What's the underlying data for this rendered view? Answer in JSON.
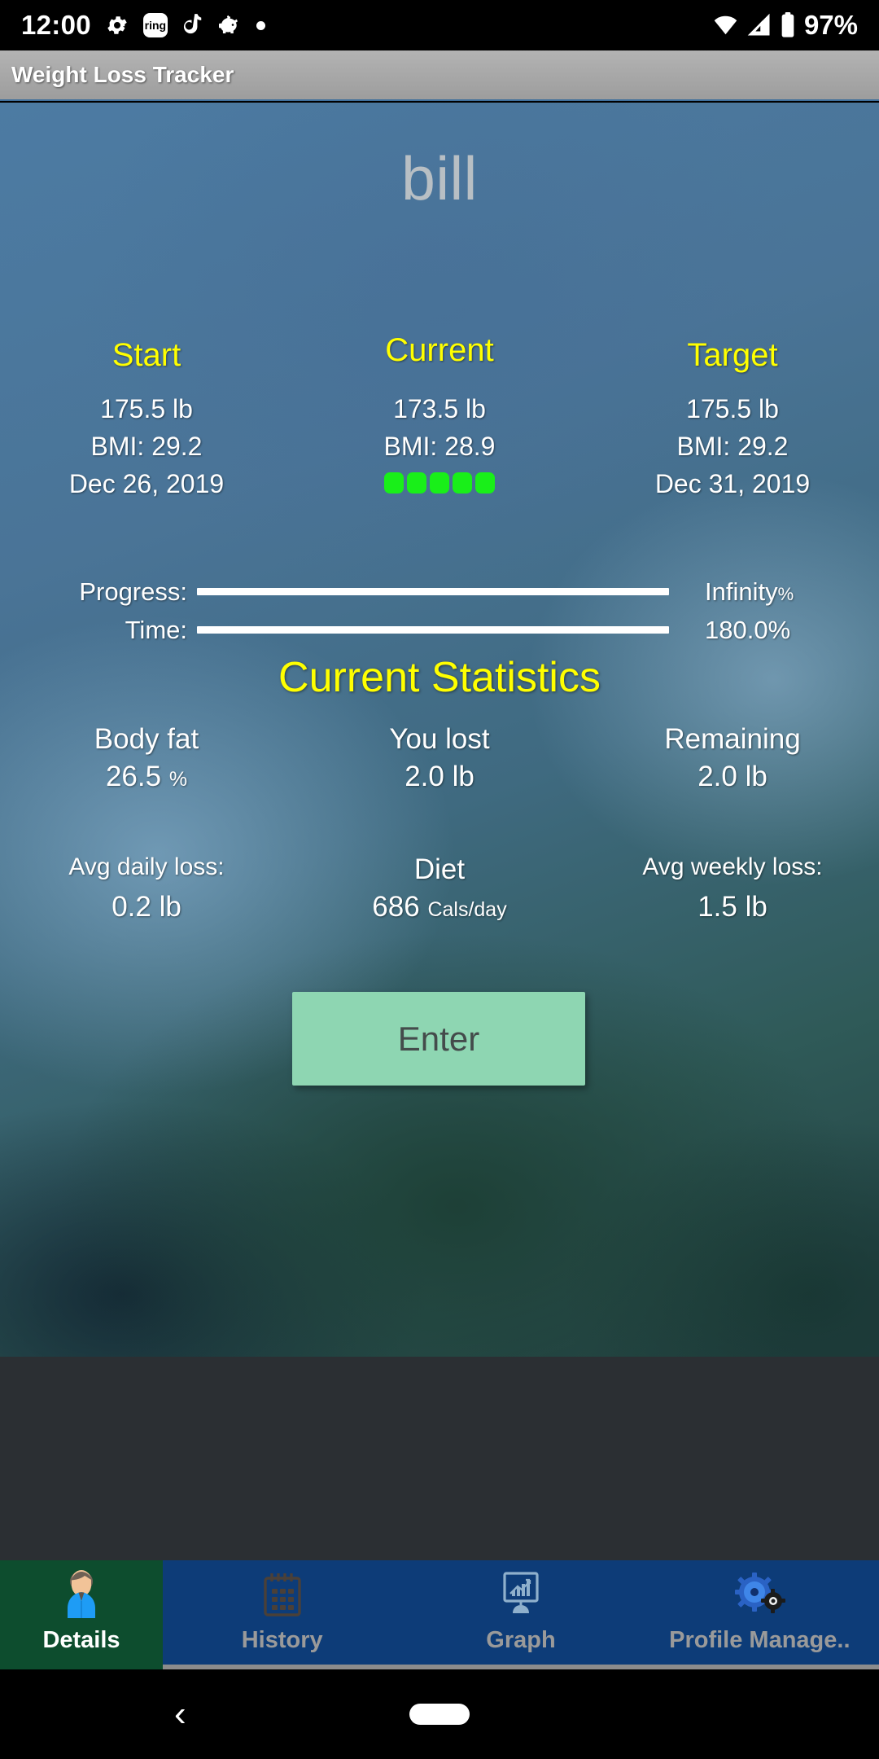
{
  "status_bar": {
    "time": "12:00",
    "battery_percent": "97%",
    "icons": [
      "gear-icon",
      "ring-app-icon",
      "tiktok-icon",
      "piggy-bank-icon",
      "dot-icon"
    ],
    "ring_label": "ring",
    "right_icons": [
      "wifi-icon",
      "cellular-signal-icon",
      "battery-icon"
    ]
  },
  "title_bar": {
    "title": "Weight Loss Tracker"
  },
  "profile": {
    "name": "bill"
  },
  "summary": {
    "columns": [
      {
        "header": "Start",
        "weight": "175.5 lb",
        "bmi": "BMI: 29.2",
        "date": "Dec 26, 2019"
      },
      {
        "header": "Current",
        "weight": "173.5 lb",
        "bmi": "BMI: 28.9",
        "date": ""
      },
      {
        "header": "Target",
        "weight": "175.5 lb",
        "bmi": "BMI: 29.2",
        "date": "Dec 31, 2019"
      }
    ],
    "indicator_dots": 5,
    "indicator_color": "#19ef19",
    "header_color": "#ffff00"
  },
  "bars": [
    {
      "label": "Progress:",
      "value": "Infinity",
      "suffix": "%",
      "fill_percent": 100
    },
    {
      "label": "Time:",
      "value": "180.0%",
      "suffix": "",
      "fill_percent": 100
    }
  ],
  "statistics": {
    "title": "Current Statistics",
    "row1": [
      {
        "label": "Body fat",
        "value": "26.5",
        "unit": "%"
      },
      {
        "label": "You lost",
        "value": "2.0 lb",
        "unit": ""
      },
      {
        "label": "Remaining",
        "value": "2.0 lb",
        "unit": ""
      }
    ],
    "row2": [
      {
        "label": "Avg daily loss:",
        "value": "0.2 lb",
        "unit": ""
      },
      {
        "label": "Diet",
        "value": "686",
        "unit": "Cals/day"
      },
      {
        "label": "Avg weekly loss:",
        "value": "1.5 lb",
        "unit": ""
      }
    ]
  },
  "enter_button": {
    "label": "Enter",
    "color": "#8ed6b2"
  },
  "tabs": [
    {
      "label": "Details",
      "icon": "person-avatar-icon",
      "active": true
    },
    {
      "label": "History",
      "icon": "calendar-icon",
      "active": false
    },
    {
      "label": "Graph",
      "icon": "monitor-chart-icon",
      "active": false
    },
    {
      "label": "Profile Manage..",
      "icon": "gears-icon",
      "active": false
    }
  ],
  "system_nav": {
    "back": "‹",
    "home_pill": ""
  }
}
